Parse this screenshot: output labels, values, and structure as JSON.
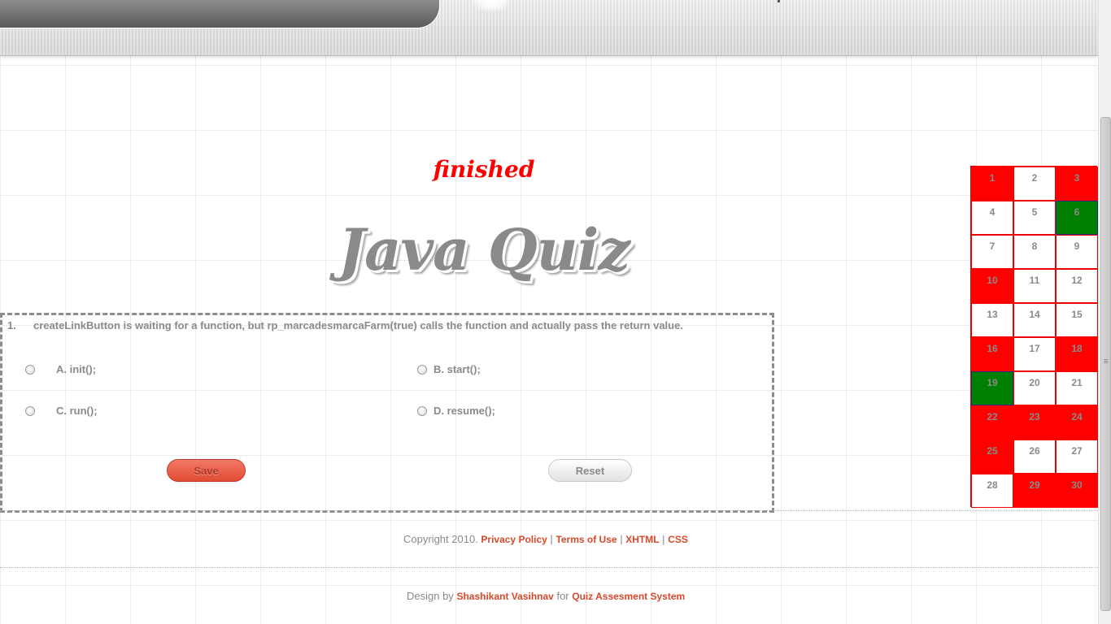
{
  "header": {
    "status": "finished",
    "title": "Java Quiz"
  },
  "question": {
    "number": "1.",
    "text": "createLinkButton is waiting for a function, but rp_marcadesmarcaFarm(true) calls the function and actually pass the return value.",
    "options": [
      {
        "label": "A. init();",
        "selected": false
      },
      {
        "label": "B. start();",
        "selected": false
      },
      {
        "label": "C. run();",
        "selected": false
      },
      {
        "label": "D. resume();",
        "selected": false
      }
    ],
    "save_label": "Save",
    "reset_label": "Reset"
  },
  "question_grid": {
    "cells": [
      {
        "n": "1",
        "status": "red"
      },
      {
        "n": "2",
        "status": "white"
      },
      {
        "n": "3",
        "status": "red"
      },
      {
        "n": "4",
        "status": "white"
      },
      {
        "n": "5",
        "status": "white"
      },
      {
        "n": "6",
        "status": "green"
      },
      {
        "n": "7",
        "status": "white"
      },
      {
        "n": "8",
        "status": "white"
      },
      {
        "n": "9",
        "status": "white"
      },
      {
        "n": "10",
        "status": "red"
      },
      {
        "n": "11",
        "status": "white"
      },
      {
        "n": "12",
        "status": "white"
      },
      {
        "n": "13",
        "status": "white"
      },
      {
        "n": "14",
        "status": "white"
      },
      {
        "n": "15",
        "status": "white"
      },
      {
        "n": "16",
        "status": "red"
      },
      {
        "n": "17",
        "status": "white"
      },
      {
        "n": "18",
        "status": "red"
      },
      {
        "n": "19",
        "status": "green"
      },
      {
        "n": "20",
        "status": "white"
      },
      {
        "n": "21",
        "status": "white"
      },
      {
        "n": "22",
        "status": "red"
      },
      {
        "n": "23",
        "status": "red"
      },
      {
        "n": "24",
        "status": "red"
      },
      {
        "n": "25",
        "status": "red"
      },
      {
        "n": "26",
        "status": "white"
      },
      {
        "n": "27",
        "status": "white"
      },
      {
        "n": "28",
        "status": "white"
      },
      {
        "n": "29",
        "status": "red"
      },
      {
        "n": "30",
        "status": "red"
      }
    ],
    "colors": {
      "red": "#ff0000",
      "green": "#008000",
      "white": "#ffffff"
    }
  },
  "footer": {
    "copyright": "Copyright 2010.",
    "privacy": "Privacy Policy",
    "terms": "Terms of Use",
    "xhtml": "XHTML",
    "css": "CSS",
    "separator": "|",
    "design_by": "Design by",
    "author": "Shashikant Vasihnav",
    "for_text": "for",
    "system": "Quiz Assesment System",
    "link_color": "#d9482b"
  }
}
